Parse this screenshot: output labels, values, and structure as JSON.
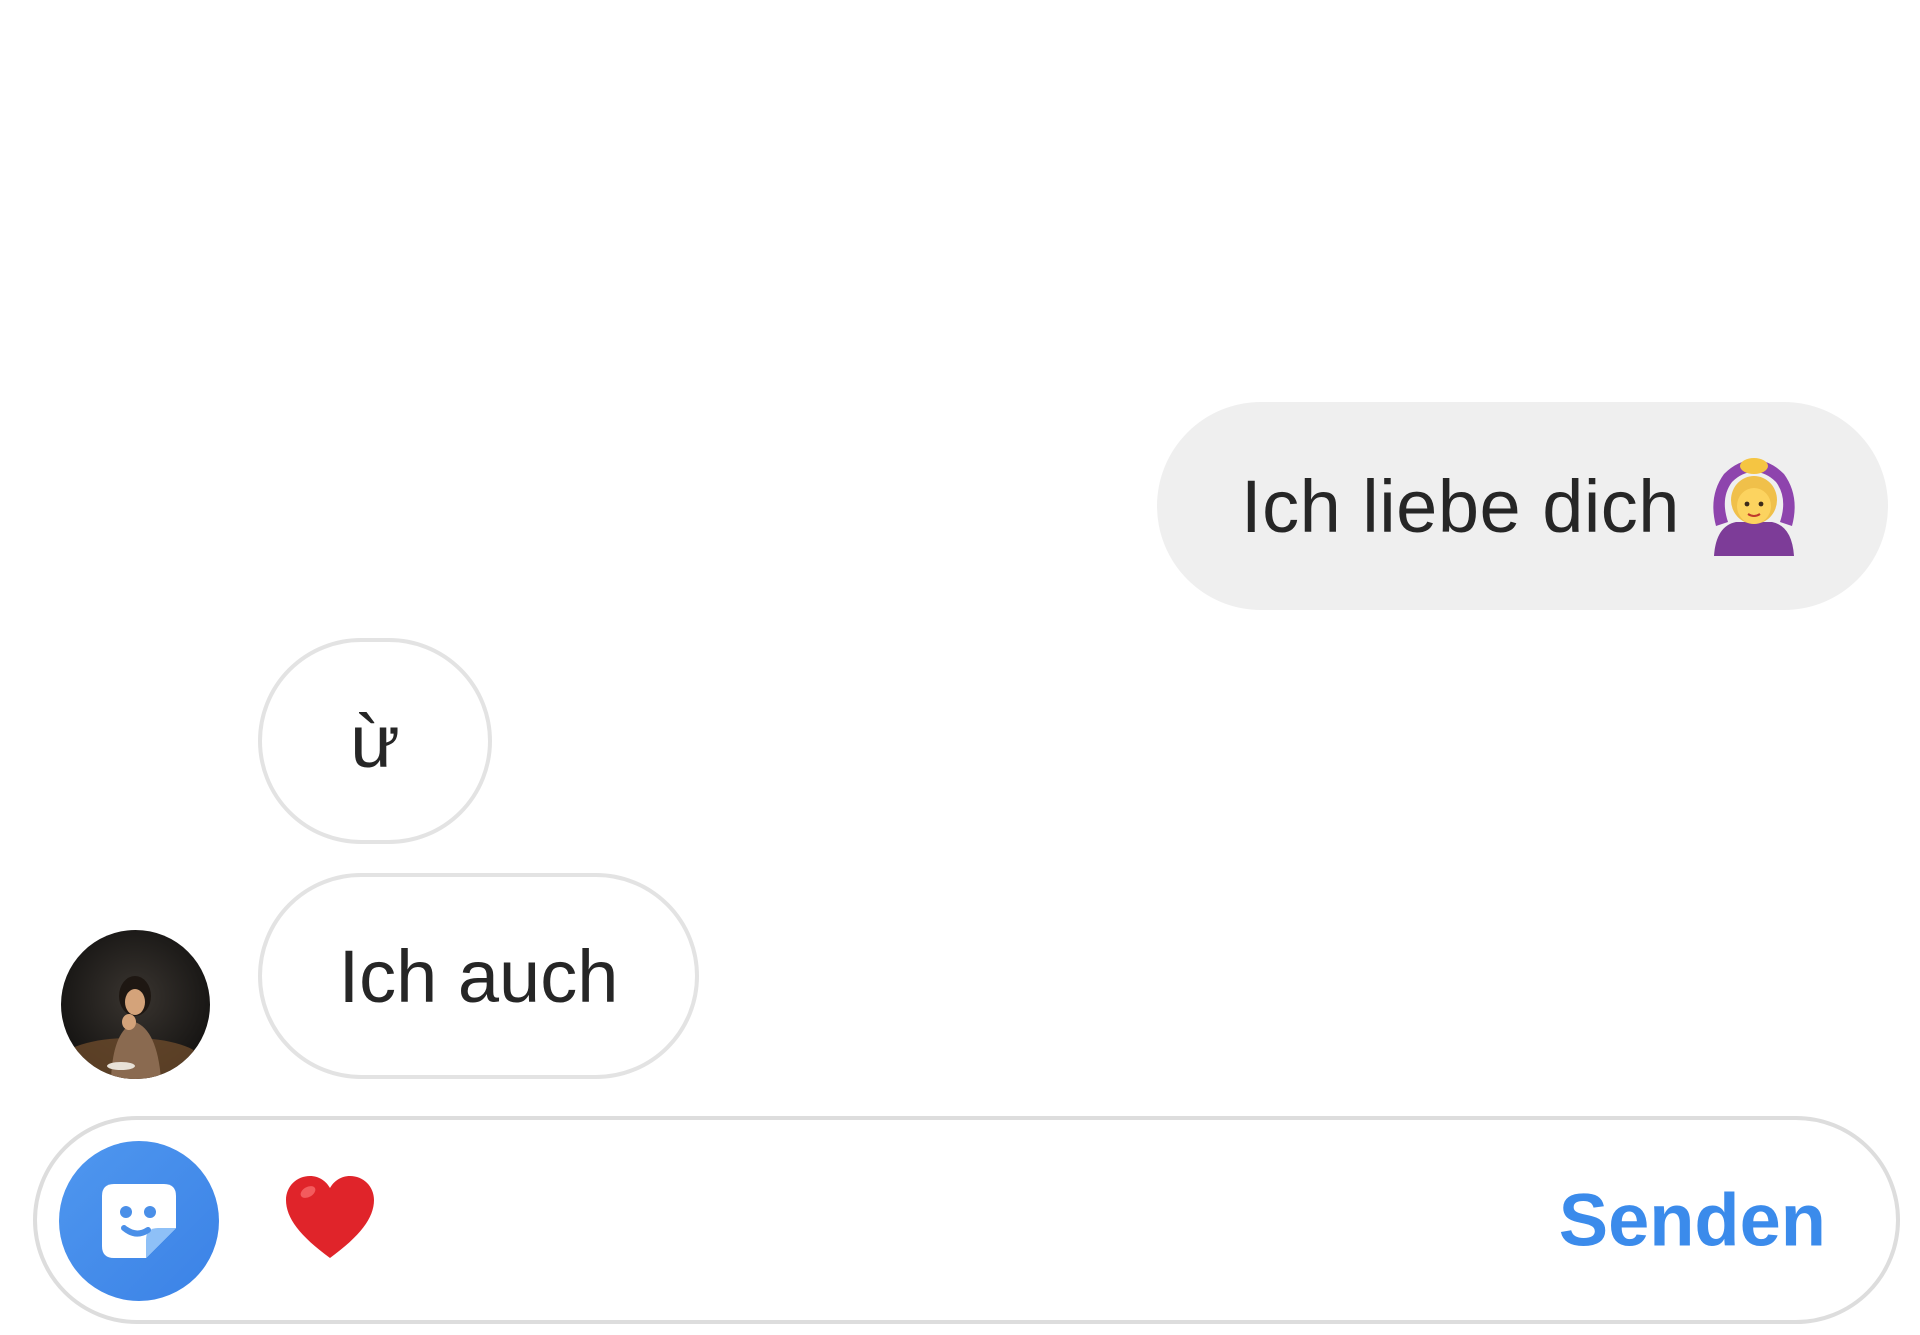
{
  "conversation": {
    "messages": [
      {
        "sender": "me",
        "text": "Ich liebe dich",
        "emoji": "person-gesturing-ok-emoji"
      },
      {
        "sender": "them",
        "text": "ừ"
      },
      {
        "sender": "them",
        "text": "Ich auch"
      }
    ]
  },
  "composer": {
    "sticker_icon": "sticker-icon",
    "heart_icon": "red-heart-icon",
    "send_label": "Senden",
    "input_value": "",
    "send_color": "#3b8beb"
  },
  "colors": {
    "sent_bubble": "#efefef",
    "received_bubble_border": "#e3e3e3",
    "accent": "#3b82e6"
  }
}
